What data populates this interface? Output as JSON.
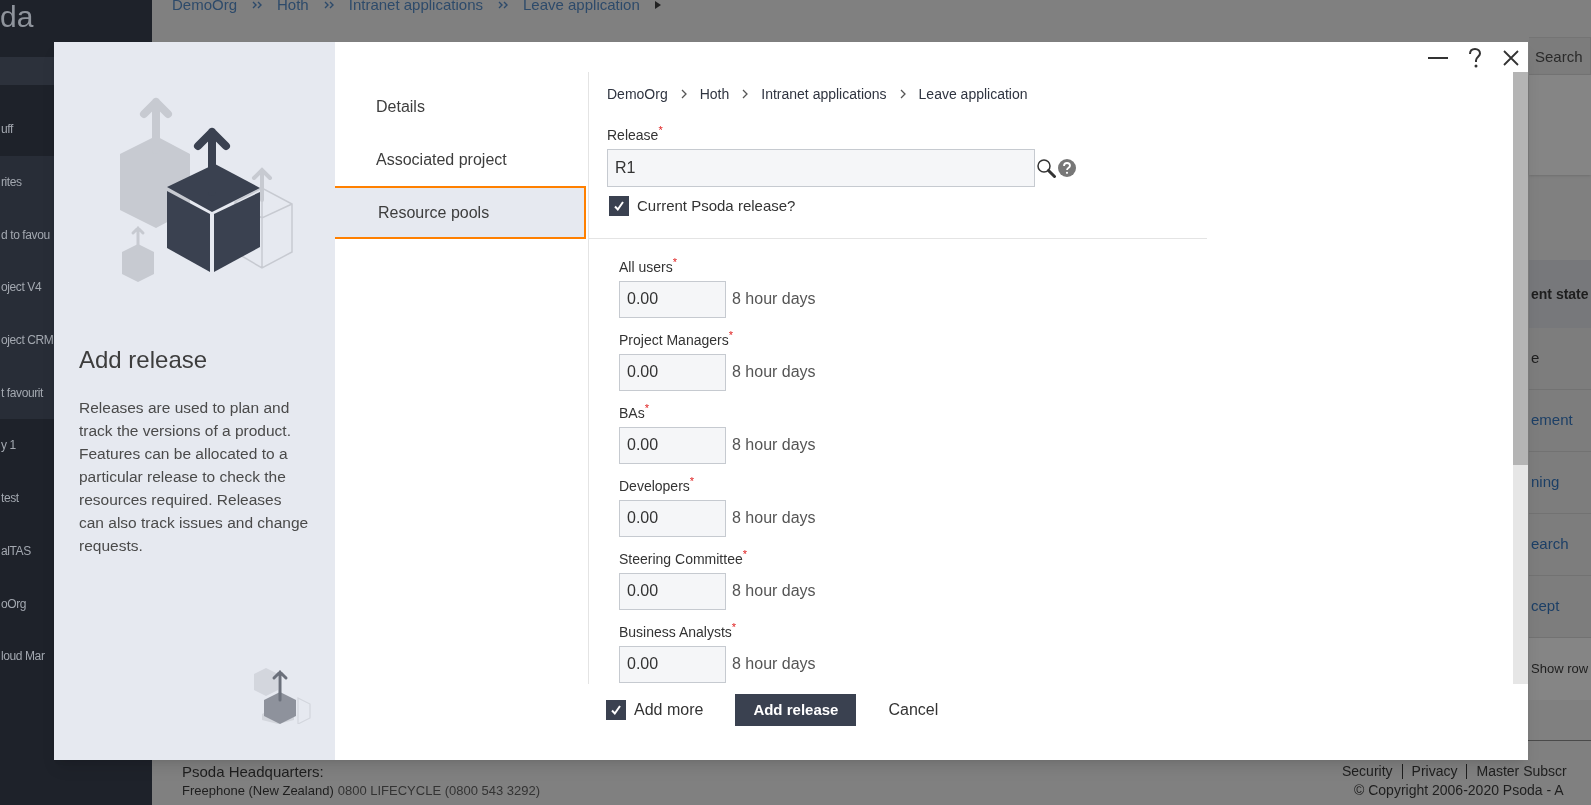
{
  "app": {
    "logo_fragment": "da"
  },
  "sidebar": {
    "sections": [
      {
        "shaded": false,
        "items": [
          "uff"
        ]
      },
      {
        "shaded": true,
        "items": [
          "rites",
          "d to favou",
          "oject V4",
          "oject CRM",
          "t favourit"
        ]
      },
      {
        "shaded": false,
        "items": [
          "y 1",
          "test",
          "alTAS",
          "oOrg",
          "loud Mar"
        ]
      }
    ]
  },
  "page_breadcrumb": [
    "DemoOrg",
    "Hoth",
    "Intranet applications",
    "Leave application"
  ],
  "page_search": {
    "placeholder": "Search"
  },
  "page_table": {
    "header": "ent state",
    "rows": [
      {
        "kind": "text",
        "text": "e"
      },
      {
        "kind": "link",
        "text": "ement"
      },
      {
        "kind": "link",
        "text": "ning"
      },
      {
        "kind": "link",
        "text": "earch"
      },
      {
        "kind": "link",
        "text": "cept"
      }
    ],
    "footer": "Show row"
  },
  "page_footer": {
    "headquarters": "Psoda Headquarters:",
    "phone_label": "Freephone (New Zealand)",
    "phone": "0800 LIFECYCLE (0800 543 3292)",
    "links": [
      "Security",
      "Privacy",
      "Master Subscr"
    ],
    "copyright": "© Copyright 2006-2020 Psoda - A"
  },
  "dialog": {
    "title": "Add release",
    "description": "Releases are used to plan and track the versions of a product. Features can be allocated to a particular release to check the resources required. Releases can also track issues and change requests.",
    "nav": [
      {
        "label": "Details",
        "selected": false
      },
      {
        "label": "Associated project",
        "selected": false
      },
      {
        "label": "Resource pools",
        "selected": true
      }
    ],
    "breadcrumb": [
      "DemoOrg",
      "Hoth",
      "Intranet applications",
      "Leave application"
    ],
    "release": {
      "label": "Release",
      "required": "*",
      "value": "R1"
    },
    "current_release": {
      "label": "Current Psoda release?",
      "checked": true
    },
    "pools": [
      {
        "label": "All users",
        "required": "*",
        "value": "0.00",
        "unit": "8 hour days"
      },
      {
        "label": "Project Managers",
        "required": "*",
        "value": "0.00",
        "unit": "8 hour days"
      },
      {
        "label": "BAs",
        "required": "*",
        "value": "0.00",
        "unit": "8 hour days"
      },
      {
        "label": "Developers",
        "required": "*",
        "value": "0.00",
        "unit": "8 hour days"
      },
      {
        "label": "Steering Committee",
        "required": "*",
        "value": "0.00",
        "unit": "8 hour days"
      },
      {
        "label": "Business Analysts",
        "required": "*",
        "value": "0.00",
        "unit": "8 hour days"
      }
    ],
    "add_more": {
      "label": "Add more",
      "checked": true
    },
    "submit": "Add release",
    "cancel": "Cancel"
  }
}
